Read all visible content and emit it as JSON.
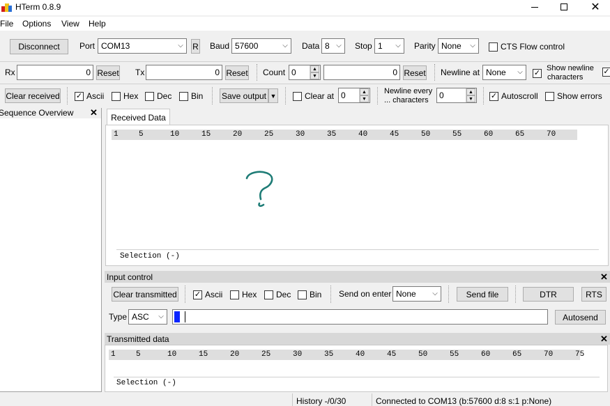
{
  "window": {
    "title": "HTerm 0.8.9"
  },
  "menu": [
    "File",
    "Options",
    "View",
    "Help"
  ],
  "connection": {
    "disconnect_label": "Disconnect",
    "port_label": "Port",
    "port_value": "COM13",
    "r_label": "R",
    "baud_label": "Baud",
    "baud_value": "57600",
    "data_label": "Data",
    "data_value": "8",
    "stop_label": "Stop",
    "stop_value": "1",
    "parity_label": "Parity",
    "parity_value": "None",
    "cts_label": "CTS Flow control"
  },
  "counters": {
    "rx_label": "Rx",
    "rx_value": "0",
    "rx_reset": "Reset",
    "tx_label": "Tx",
    "tx_value": "0",
    "tx_reset": "Reset",
    "count_label": "Count",
    "count_value": "0",
    "count_field": "0",
    "count_reset": "Reset",
    "newline_at_label": "Newline at",
    "newline_at_value": "None",
    "show_newline_label_1": "Show newline",
    "show_newline_label_2": "characters"
  },
  "receive_toolbar": {
    "clear_received": "Clear received",
    "ascii": "Ascii",
    "hex": "Hex",
    "dec": "Dec",
    "bin": "Bin",
    "save_output": "Save output",
    "clear_at": "Clear at",
    "clear_at_value": "0",
    "newline_every_1": "Newline every",
    "newline_every_2": "... characters",
    "newline_every_value": "0",
    "autoscroll": "Autoscroll",
    "show_errors": "Show errors"
  },
  "sequence_overview": {
    "title": "Sequence Overview"
  },
  "received": {
    "tab": "Received Data",
    "ruler": [
      "1",
      "5",
      "10",
      "15",
      "20",
      "25",
      "30",
      "35",
      "40",
      "45",
      "50",
      "55",
      "60",
      "65",
      "70"
    ],
    "selection": "Selection (-)"
  },
  "input_control": {
    "title": "Input control",
    "clear_transmitted": "Clear transmitted",
    "ascii": "Ascii",
    "hex": "Hex",
    "dec": "Dec",
    "bin": "Bin",
    "send_on_enter_label": "Send on enter",
    "send_on_enter_value": "None",
    "send_file": "Send file",
    "dtr": "DTR",
    "rts": "RTS",
    "type_label": "Type",
    "type_value": "ASC",
    "input_value": "",
    "autosend": "Autosend"
  },
  "transmitted": {
    "title": "Transmitted data",
    "ruler": [
      "1",
      "5",
      "10",
      "15",
      "20",
      "25",
      "30",
      "35",
      "40",
      "45",
      "50",
      "55",
      "60",
      "65",
      "70",
      "75"
    ],
    "selection": "Selection (-)"
  },
  "status": {
    "history": "History -/0/30",
    "connection": "Connected to COM13 (b:57600 d:8 s:1 p:None)"
  }
}
